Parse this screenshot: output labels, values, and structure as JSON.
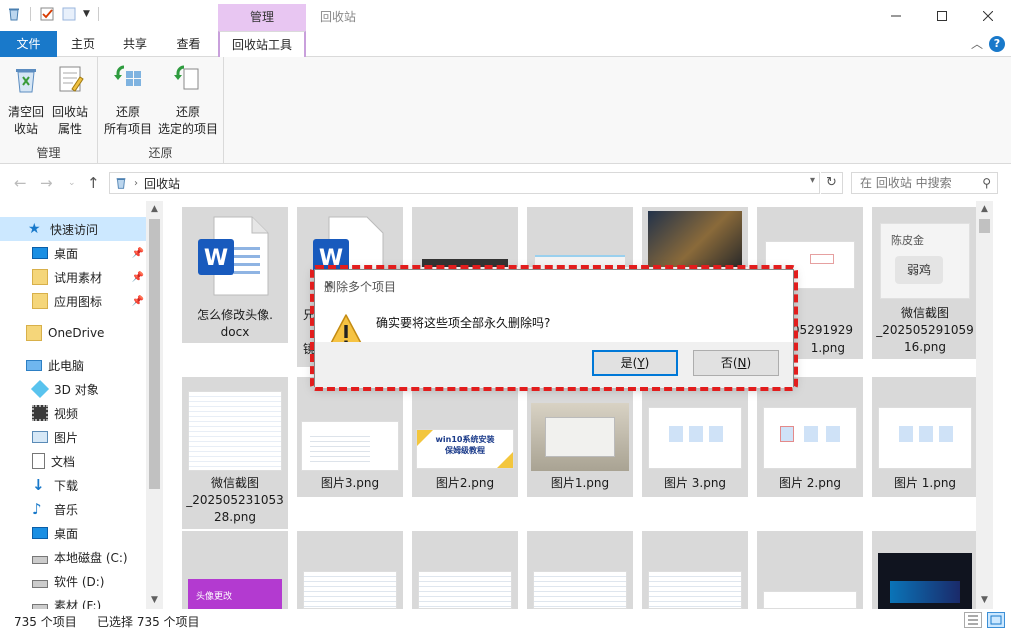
{
  "window": {
    "title": "回收站",
    "context_tab": "管理",
    "icons": [
      "recycle-bin-icon",
      "properties-check-icon",
      "new-folder-icon",
      "qat-dropdown-icon"
    ]
  },
  "ribbon_tabs": [
    {
      "label": "文件"
    },
    {
      "label": "主页"
    },
    {
      "label": "共享"
    },
    {
      "label": "查看"
    },
    {
      "label": "回收站工具"
    }
  ],
  "ribbon": {
    "groups": [
      {
        "label": "管理",
        "buttons": [
          {
            "line1": "清空回",
            "line2": "收站"
          },
          {
            "line1": "回收站",
            "line2": "属性"
          }
        ]
      },
      {
        "label": "还原",
        "buttons": [
          {
            "line1": "还原",
            "line2": "所有项目"
          },
          {
            "line1": "还原",
            "line2": "选定的项目"
          }
        ]
      }
    ]
  },
  "address": {
    "crumb": "回收站",
    "search_placeholder": "在 回收站 中搜索"
  },
  "nav": {
    "quick_access": "快速访问",
    "pinned": [
      "桌面",
      "试用素材",
      "应用图标"
    ],
    "onedrive": "OneDrive",
    "this_pc": "此电脑",
    "pc_items": [
      "3D 对象",
      "视频",
      "图片",
      "文档",
      "下载",
      "音乐",
      "桌面",
      "本地磁盘 (C:)",
      "软件 (D:)",
      "素材 (F:)"
    ]
  },
  "files": {
    "row1": [
      {
        "l1": "怎么修改头像.",
        "l2": "docx"
      },
      {
        "l1": "兄",
        "l2": "镜"
      },
      {
        "l1": "",
        "l2": ""
      },
      {
        "l1": "",
        "l2": ""
      },
      {
        "l1": "",
        "l2": ""
      },
      {
        "l1": "05291929",
        "l2": "1.png"
      },
      {
        "l1": "微信截图",
        "l2": "_202505291059",
        "l3": "16.png"
      }
    ],
    "row2": [
      {
        "l1": "微信截图",
        "l2": "_202505231053",
        "l3": "28.png"
      },
      {
        "l1": "图片3.png"
      },
      {
        "l1": "图片2.png"
      },
      {
        "l1": "图片1.png"
      },
      {
        "l1": "图片 3.png"
      },
      {
        "l1": "图片 2.png"
      },
      {
        "l1": "图片 1.png"
      }
    ],
    "thumb_texts": {
      "name_card_name": "陈皮金",
      "name_card_tag": "弱鸡",
      "banner_line1": "win10系统安装",
      "banner_line2": "保姆级教程",
      "avatar_banner": "头像更改"
    }
  },
  "status": {
    "count": "735 个项目",
    "selected": "已选择 735 个项目"
  },
  "dialog": {
    "title": "删除多个项目",
    "message": "确实要将这些项全部永久删除吗?",
    "yes_label": "是(",
    "yes_key": "Y",
    "yes_end": ")",
    "no_label": "否(",
    "no_key": "N",
    "no_end": ")"
  }
}
